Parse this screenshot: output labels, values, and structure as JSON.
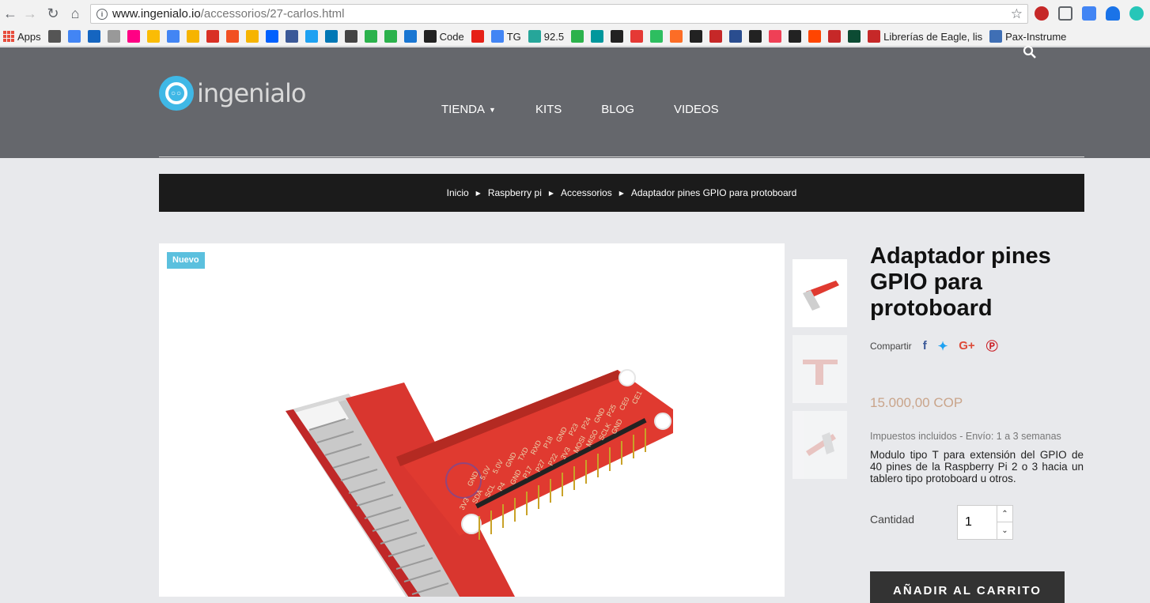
{
  "browser": {
    "url_host": "www.ingenialo.io",
    "url_path": "/accessorios/27-carlos.html",
    "bookmarks": [
      {
        "label": "Apps",
        "icon": "apps-grid-icon",
        "color": "#e74c3c"
      },
      {
        "label": "",
        "icon": "star-icon",
        "color": "#555"
      },
      {
        "label": "",
        "icon": "analytics-icon",
        "color": "#4285f4"
      },
      {
        "label": "",
        "icon": "power-icon",
        "color": "#1565c0"
      },
      {
        "label": "",
        "icon": "ec-icon",
        "color": "#999"
      },
      {
        "label": "",
        "icon": "flickr-icon",
        "color": "#ff0084"
      },
      {
        "label": "",
        "icon": "drive-icon",
        "color": "#fbbc05"
      },
      {
        "label": "",
        "icon": "calendar-icon",
        "color": "#4285f4"
      },
      {
        "label": "",
        "icon": "keep-icon",
        "color": "#f6b400"
      },
      {
        "label": "",
        "icon": "gmail-icon",
        "color": "#d93025"
      },
      {
        "label": "",
        "icon": "office-icon",
        "color": "#f25022"
      },
      {
        "label": "",
        "icon": "outlook-icon",
        "color": "#f6b400"
      },
      {
        "label": "",
        "icon": "dropbox-icon",
        "color": "#0061fe"
      },
      {
        "label": "",
        "icon": "facebook-icon",
        "color": "#3b5998"
      },
      {
        "label": "",
        "icon": "twitter-icon",
        "color": "#1da1f2"
      },
      {
        "label": "",
        "icon": "linkedin-icon",
        "color": "#0077b5"
      },
      {
        "label": "",
        "icon": "instagram-icon",
        "color": "#444"
      },
      {
        "label": "",
        "icon": "one-icon",
        "color": "#2bb24c"
      },
      {
        "label": "",
        "icon": "send-icon",
        "color": "#2bb24c"
      },
      {
        "label": "",
        "icon": "hourglass-icon",
        "color": "#1976d2"
      },
      {
        "label": "Code",
        "icon": "github-icon",
        "color": "#222"
      },
      {
        "label": "",
        "icon": "youtube-icon",
        "color": "#e62117"
      },
      {
        "label": "TG",
        "icon": "translate-icon",
        "color": "#4285f4"
      },
      {
        "label": "92.5",
        "icon": "radio-icon",
        "color": "#26a69a"
      },
      {
        "label": "",
        "icon": "feedly-icon",
        "color": "#2bb24c"
      },
      {
        "label": "",
        "icon": "arduino-icon",
        "color": "#00979c"
      },
      {
        "label": "",
        "icon": "starred-icon",
        "color": "#222"
      },
      {
        "label": "",
        "icon": "red-flag-icon",
        "color": "#e53935"
      },
      {
        "label": "",
        "icon": "evernote-icon",
        "color": "#2dbe60"
      },
      {
        "label": "",
        "icon": "gitlab-icon",
        "color": "#fc6d26"
      },
      {
        "label": "",
        "icon": "github-alt-icon",
        "color": "#222"
      },
      {
        "label": "",
        "icon": "video-icon",
        "color": "#c62828"
      },
      {
        "label": "",
        "icon": "m-icon",
        "color": "#2a4d8f"
      },
      {
        "label": "",
        "icon": "amazon-icon",
        "color": "#222"
      },
      {
        "label": "",
        "icon": "pocket-icon",
        "color": "#ef4056"
      },
      {
        "label": "",
        "icon": "p-icon",
        "color": "#222"
      },
      {
        "label": "",
        "icon": "reddit-icon",
        "color": "#ff4500"
      },
      {
        "label": "",
        "icon": "cat-icon",
        "color": "#c62828"
      },
      {
        "label": "",
        "icon": "django-icon",
        "color": "#0c4b33"
      },
      {
        "label": "Librerías de Eagle, lis",
        "icon": "t-icon",
        "color": "#c62828"
      },
      {
        "label": "Pax-Instrume",
        "icon": "m-blue-icon",
        "color": "#3f6fb5"
      }
    ]
  },
  "site": {
    "logo_text": "ingenialo",
    "nav": [
      {
        "label": "TIENDA",
        "has_caret": true
      },
      {
        "label": "KITS"
      },
      {
        "label": "BLOG"
      },
      {
        "label": "VIDEOS"
      }
    ]
  },
  "breadcrumb": [
    "Inicio",
    "Raspberry pi",
    "Accessorios",
    "Adaptador pines GPIO para protoboard"
  ],
  "product": {
    "badge": "Nuevo",
    "title": "Adaptador pines GPIO para protoboard",
    "share_label": "Compartir",
    "price": "15.000,00 COP",
    "tax_info": "Impuestos incluidos - Envío: 1 a 3 semanas",
    "description": "Modulo tipo T para extensión del GPIO de 40 pines de la Raspberry Pi 2 o 3 hacia un tablero tipo protoboard u otros.",
    "quantity_label": "Cantidad",
    "quantity": "1",
    "add_to_cart": "AÑADIR AL CARRITO",
    "board_pin_labels": [
      "GND",
      "5.0V",
      "5.0V",
      "GND",
      "TXD",
      "RXD",
      "P18",
      "GND",
      "P23",
      "P24",
      "GND",
      "P25",
      "CE0",
      "CE1"
    ],
    "board_pin_labels_2": [
      "3V3",
      "SDA",
      "SCL",
      "P4",
      "GND",
      "P17",
      "P27",
      "P22",
      "3V3",
      "MOSI",
      "MISO",
      "SCLK",
      "GND"
    ]
  },
  "colors": {
    "header_bg": "#65676c",
    "breadcrumb_bg": "#1b1b1b",
    "badge": "#5bc0de",
    "price": "#c9a48a",
    "cart_button": "#333333",
    "accent": "#3fb8e6"
  }
}
